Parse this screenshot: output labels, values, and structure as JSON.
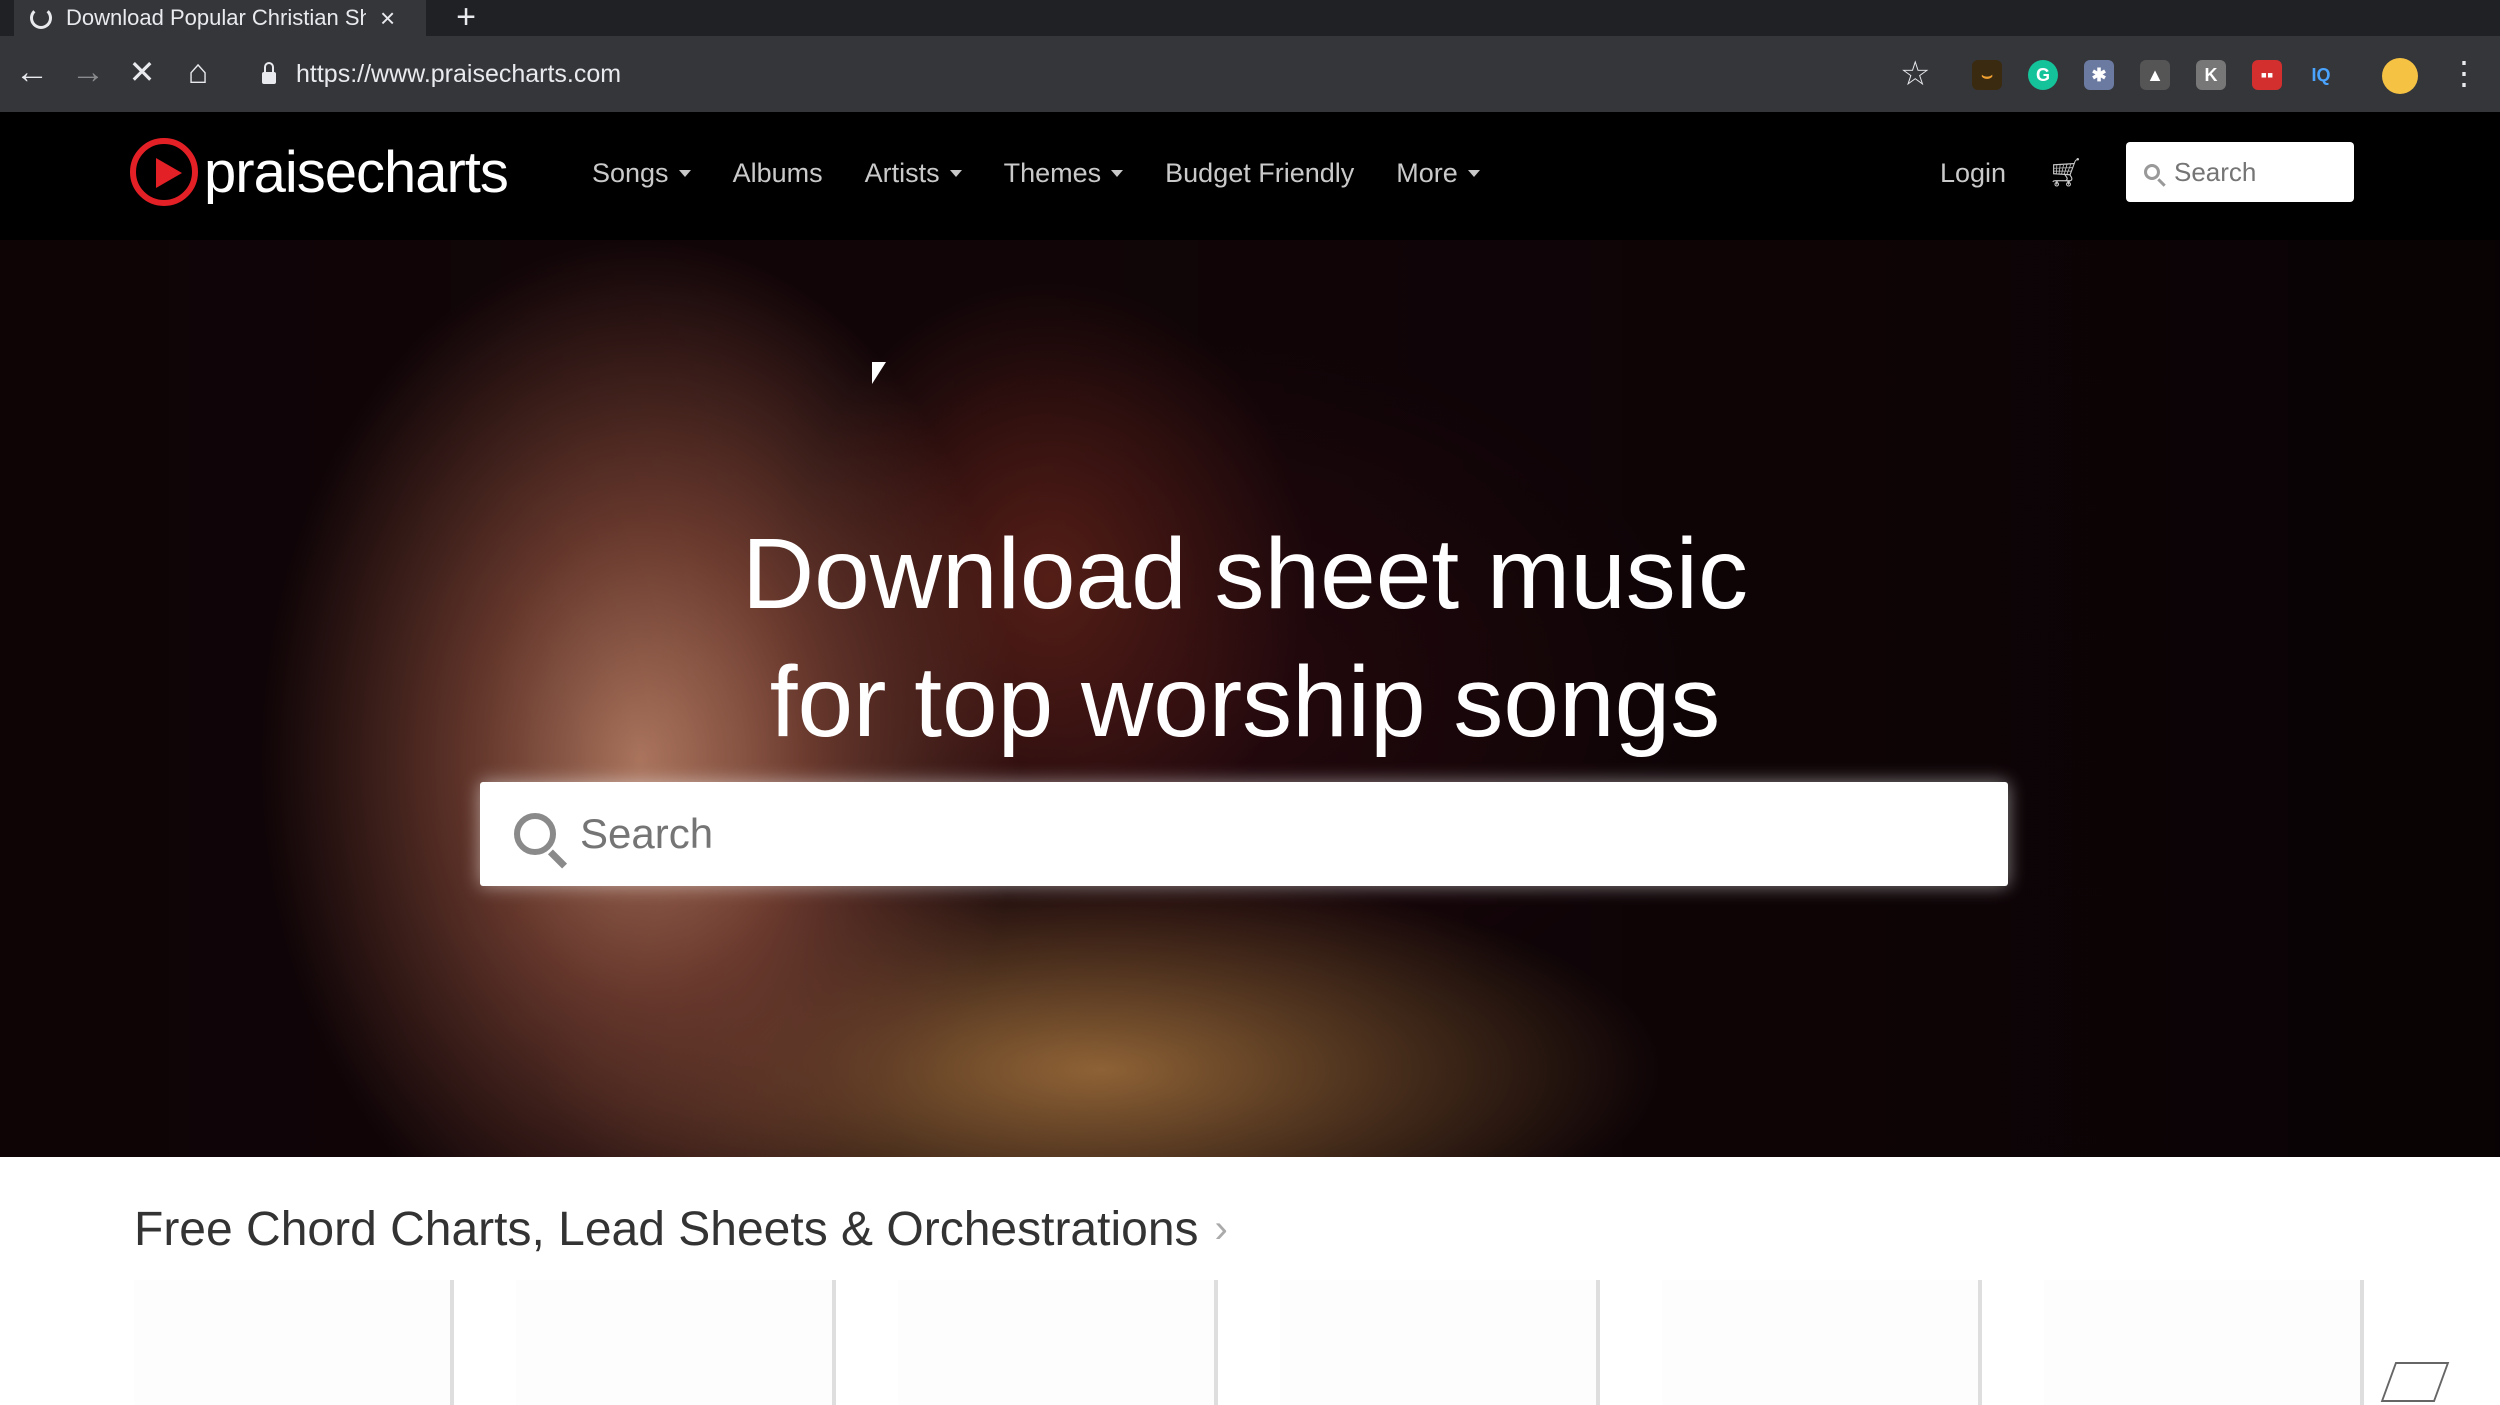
{
  "browser": {
    "tab_title": "Download Popular Christian Sh",
    "new_tab_symbol": "+",
    "close_symbol": "×",
    "url": "https://www.praisecharts.com"
  },
  "site": {
    "logo_text": "praisecharts",
    "nav": {
      "songs": "Songs",
      "albums": "Albums",
      "artists": "Artists",
      "themes": "Themes",
      "budget": "Budget Friendly",
      "more": "More"
    },
    "login": "Login",
    "header_search_placeholder": "Search"
  },
  "hero": {
    "headline_line1": "Download sheet music",
    "headline_line2": "for top worship songs",
    "search_placeholder": "Search"
  },
  "section": {
    "title": "Free Chord Charts, Lead Sheets & Orchestrations",
    "chevron": "›"
  },
  "colors": {
    "brand_red": "#e32026",
    "header_bg": "#000000",
    "browser_chrome": "#35363a"
  }
}
